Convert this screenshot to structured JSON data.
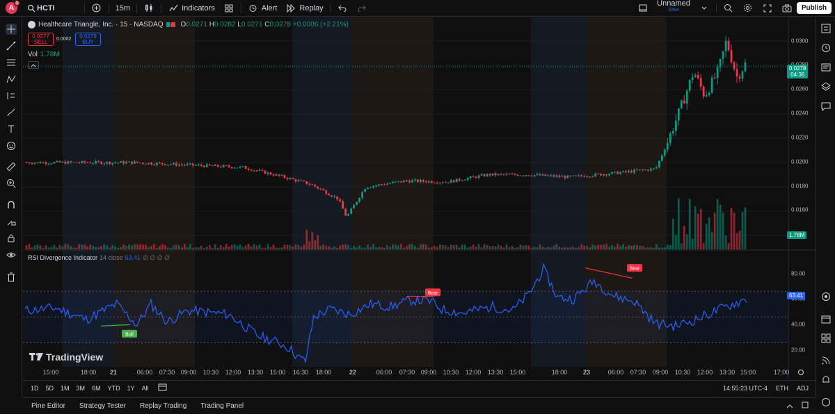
{
  "header": {
    "avatar_letter": "A",
    "notif_count": "1",
    "symbol": "HCTI",
    "interval": "15m",
    "indicators_label": "Indicators",
    "alert_label": "Alert",
    "replay_label": "Replay",
    "layout_name": "Unnamed",
    "layout_sub": "Save",
    "publish_label": "Publish"
  },
  "legend": {
    "title": "Healthcare Triangle, Inc. · 15 · NASDAQ",
    "o_label": "O",
    "o": "0.0271",
    "h_label": "H",
    "h": "0.0282",
    "l_label": "L",
    "l": "0.0271",
    "c_label": "C",
    "c": "0.0278",
    "change": "+0.0006 (+2.21%)",
    "sell_price": "0.0277",
    "sell_label": "SELL",
    "spread": "0.0002",
    "buy_price": "0.0279",
    "buy_label": "BUY",
    "vol_label": "Vol",
    "vol_value": "1.78M"
  },
  "rsi": {
    "name": "RSI Divergence Indicator",
    "params": "14 close",
    "value": "63.41",
    "extra": "∅ ∅ ∅ ∅",
    "bull_label": "Bull",
    "bear_label": "Bear",
    "axis_labels": [
      "80.00",
      "60.00",
      "40.00",
      "20.00"
    ]
  },
  "price_axis": {
    "labels": [
      "0.0300",
      "0.0280",
      "0.0260",
      "0.0240",
      "0.0220",
      "0.0200",
      "0.0180",
      "0.0160"
    ],
    "last_price": "0.0278",
    "countdown": "04:36",
    "vol_tag": "1.78M"
  },
  "time_axis": {
    "labels": [
      "15:00",
      "18:00",
      "21",
      "06:00",
      "07:30",
      "09:00",
      "10:30",
      "12:00",
      "13:30",
      "15:00",
      "16:30",
      "18:00",
      "22",
      "06:00",
      "07:30",
      "09:00",
      "10:30",
      "12:00",
      "13:30",
      "15:00",
      "18:00",
      "23",
      "06:00",
      "07:30",
      "09:00",
      "10:30",
      "12:00",
      "13:30",
      "15:00",
      "17:00"
    ]
  },
  "range_bar": {
    "ranges": [
      "1D",
      "5D",
      "1M",
      "3M",
      "6M",
      "YTD",
      "1Y",
      "All"
    ],
    "clock": "14:55:23 UTC-4",
    "session": "ETH",
    "adj": "ADJ"
  },
  "bottom_tabs": [
    "Pine Editor",
    "Strategy Tester",
    "Replay Trading",
    "Trading Panel"
  ],
  "brand": "TradingView",
  "colors": {
    "up": "#089981",
    "down": "#f23645",
    "rsi_line": "#2962ff",
    "accent": "#2962ff"
  }
}
